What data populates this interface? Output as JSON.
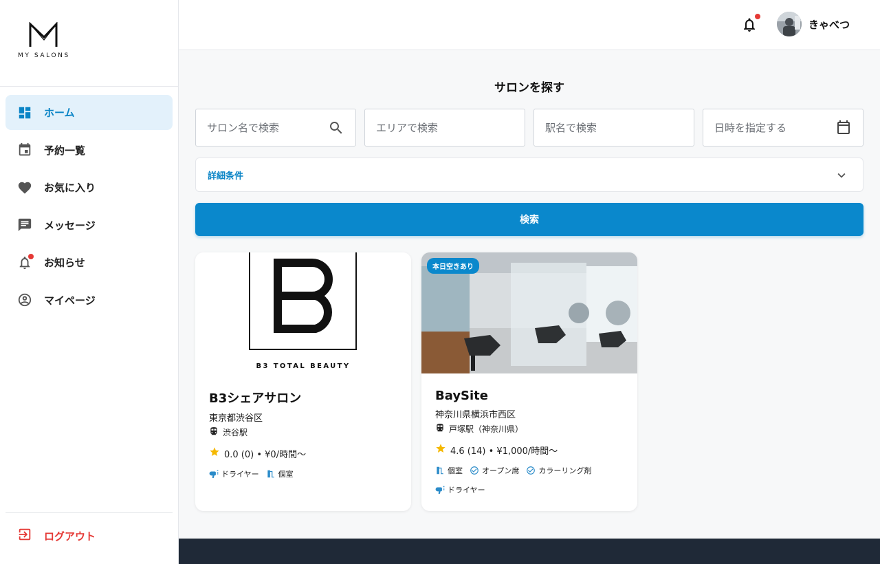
{
  "brand": {
    "logo_text": "MY SALONS"
  },
  "sidebar": {
    "items": [
      {
        "label": "ホーム",
        "icon": "dashboard-icon"
      },
      {
        "label": "予約一覧",
        "icon": "calendar-icon"
      },
      {
        "label": "お気に入り",
        "icon": "heart-icon"
      },
      {
        "label": "メッセージ",
        "icon": "message-icon"
      },
      {
        "label": "お知らせ",
        "icon": "bell-icon"
      },
      {
        "label": "マイページ",
        "icon": "account-circle-icon"
      }
    ],
    "logout_label": "ログアウト"
  },
  "header": {
    "user_name": "きゃべつ"
  },
  "main": {
    "title": "サロンを探す",
    "search": {
      "salon_placeholder": "サロン名で検索",
      "area_placeholder": "エリアで検索",
      "station_placeholder": "駅名で検索",
      "datetime_placeholder": "日時を指定する"
    },
    "details_label": "詳細条件",
    "search_button": "検索"
  },
  "cards": [
    {
      "logo_caption": "B3 TOTAL BEAUTY",
      "name": "B3シェアサロン",
      "address": "東京都渋谷区",
      "station": "渋谷駅",
      "rating": "0.0 (0) • ¥0/時間〜",
      "tags": [
        "ドライヤー",
        "個室"
      ]
    },
    {
      "badge": "本日空きあり",
      "name": "BaySite",
      "address": "神奈川県横浜市西区",
      "station": "戸塚駅（神奈川県）",
      "rating": "4.6 (14) • ¥1,000/時間〜",
      "tags": [
        "個室",
        "オープン席",
        "カラーリング剤",
        "ドライヤー"
      ]
    }
  ],
  "colors": {
    "accent": "#0a88cc",
    "danger": "#e53935",
    "footer": "#1f2937"
  }
}
